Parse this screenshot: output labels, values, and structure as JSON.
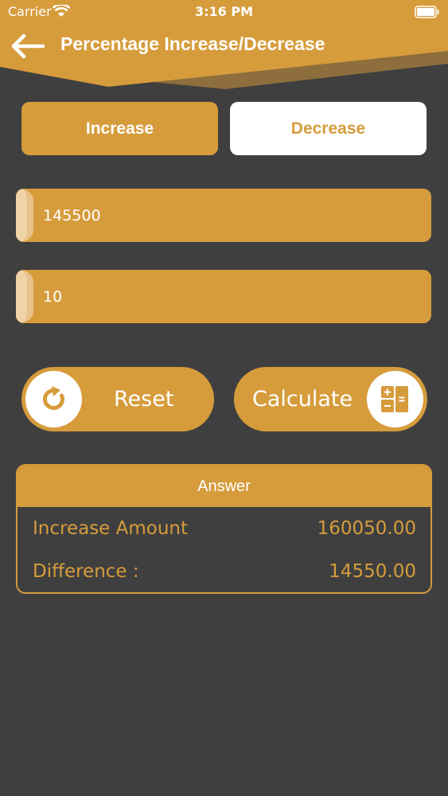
{
  "status_bar": {
    "carrier": "Carrier",
    "time": "3:16 PM"
  },
  "nav": {
    "title": "Percentage Increase/Decrease"
  },
  "tabs": [
    {
      "label": "Increase",
      "selected": false
    },
    {
      "label": "Decrease",
      "selected": true
    }
  ],
  "inputs": {
    "value": "145500",
    "percent": "10"
  },
  "buttons": {
    "reset_label": "Reset",
    "calculate_label": "Calculate"
  },
  "answer": {
    "title": "Answer",
    "rows": [
      {
        "label": "Increase Amount",
        "value": "160050.00"
      },
      {
        "label": "Difference :",
        "value": "14550.00"
      }
    ]
  },
  "colors": {
    "accent": "#d69c3c",
    "background": "#3f3f3f",
    "header_shadow": "#8d6e3c"
  }
}
